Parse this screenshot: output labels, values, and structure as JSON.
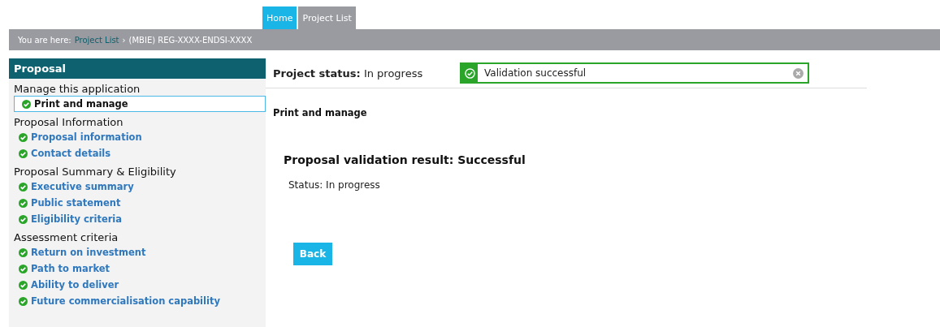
{
  "tabs": [
    {
      "label": "Home",
      "selected": true
    },
    {
      "label": "Project List",
      "selected": false
    }
  ],
  "breadcrumb": {
    "prefix": "You are here:",
    "link": "Project List",
    "separator": "›",
    "current": "(MBIE) REG-XXXX-ENDSI-XXXX"
  },
  "sidebar": {
    "title": "Proposal",
    "sections": [
      {
        "heading": "Manage this application",
        "items": [
          {
            "label": "Print and manage",
            "selected": true,
            "complete": true
          }
        ]
      },
      {
        "heading": "Proposal Information",
        "items": [
          {
            "label": "Proposal information",
            "selected": false,
            "complete": true
          },
          {
            "label": "Contact details",
            "selected": false,
            "complete": true
          }
        ]
      },
      {
        "heading": "Proposal Summary & Eligibility",
        "items": [
          {
            "label": "Executive summary",
            "selected": false,
            "complete": true
          },
          {
            "label": "Public statement",
            "selected": false,
            "complete": true
          },
          {
            "label": "Eligibility criteria",
            "selected": false,
            "complete": true
          }
        ]
      },
      {
        "heading": "Assessment criteria",
        "items": [
          {
            "label": "Return on investment",
            "selected": false,
            "complete": true
          },
          {
            "label": "Path to market",
            "selected": false,
            "complete": true
          },
          {
            "label": "Ability to deliver",
            "selected": false,
            "complete": true
          },
          {
            "label": "Future commercialisation capability",
            "selected": false,
            "complete": true
          }
        ]
      }
    ]
  },
  "project_status": {
    "label": "Project status:",
    "value": "In progress"
  },
  "alert": {
    "kind": "success",
    "message": "Validation successful"
  },
  "page_title": "Print and manage",
  "result_heading": "Proposal validation result: Successful",
  "status_line": "Status: In progress",
  "buttons": [
    "Back"
  ]
}
